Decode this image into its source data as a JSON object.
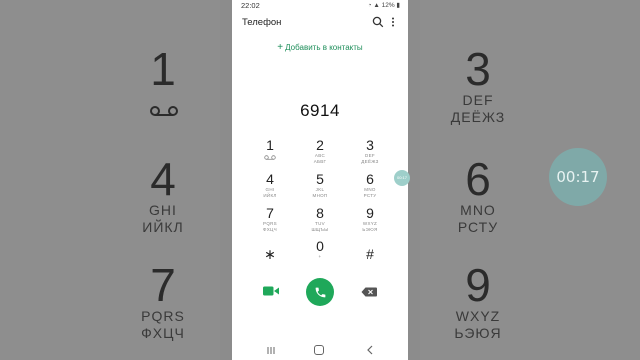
{
  "status_bar": {
    "time": "22:02",
    "battery": "12%"
  },
  "header": {
    "title": "Телефон"
  },
  "add_contact": {
    "label": "Добавить в контакты"
  },
  "dialed_number": "6914",
  "keypad": [
    {
      "digit": "1",
      "lat": "",
      "cyr": "",
      "voicemail": true
    },
    {
      "digit": "2",
      "lat": "ABC",
      "cyr": "АБВГ"
    },
    {
      "digit": "3",
      "lat": "DEF",
      "cyr": "ДЕЁЖЗ"
    },
    {
      "digit": "4",
      "lat": "GHI",
      "cyr": "ИЙКЛ"
    },
    {
      "digit": "5",
      "lat": "JKL",
      "cyr": "МНОП"
    },
    {
      "digit": "6",
      "lat": "MNO",
      "cyr": "РСТУ"
    },
    {
      "digit": "7",
      "lat": "PQRS",
      "cyr": "ФХЦЧ"
    },
    {
      "digit": "8",
      "lat": "TUV",
      "cyr": "ШЩЪЫ"
    },
    {
      "digit": "9",
      "lat": "WXYZ",
      "cyr": "ЬЭЮЯ"
    },
    {
      "digit": "∗",
      "lat": "",
      "cyr": ""
    },
    {
      "digit": "0",
      "lat": "+",
      "cyr": ""
    },
    {
      "digit": "#",
      "lat": "",
      "cyr": ""
    }
  ],
  "floating_timer": "00:17",
  "floating_bubble": "00:17",
  "background": {
    "keys": [
      {
        "digit": "1",
        "lat": "",
        "cyr": ""
      },
      {
        "digit": "4",
        "lat": "GHI",
        "cyr": "ИЙКЛ"
      },
      {
        "digit": "7",
        "lat": "PQRS",
        "cyr": "ФХЦЧ"
      },
      {
        "digit": "3",
        "lat": "DEF",
        "cyr": "ДЕЁЖЗ"
      },
      {
        "digit": "6",
        "lat": "MNO",
        "cyr": "РСТУ"
      },
      {
        "digit": "9",
        "lat": "WXYZ",
        "cyr": "ЬЭЮЯ"
      }
    ]
  },
  "colors": {
    "accent": "#1e8e5a",
    "call": "#1fa85a"
  }
}
